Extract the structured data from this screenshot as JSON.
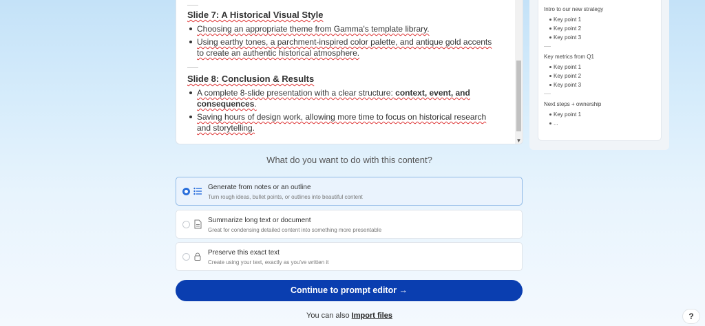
{
  "editor": {
    "slide7": {
      "title": "Slide 7: A Historical Visual Style",
      "bullets": [
        "Choosing an appropriate theme from Gamma's template library.",
        "Using earthy tones, a parchment-inspired color palette, and antique gold accents to create an authentic historical atmosphere."
      ]
    },
    "slide8": {
      "title": "Slide 8: Conclusion & Results",
      "bullet1_pre": "A complete 8-slide presentation with a clear structure: ",
      "bullet1_bold": "context, event, and consequences",
      "bullet1_post": ".",
      "bullet2": "Saving hours of design work, allowing more time to focus on historical research and storytelling."
    }
  },
  "preview": {
    "groups": [
      {
        "title": "Intro to our new strategy",
        "items": [
          "Key point 1",
          "Key point 2",
          "Key point 3"
        ]
      },
      {
        "title": "Key metrics from Q1",
        "items": [
          "Key point 1",
          "Key point 2",
          "Key point 3"
        ]
      },
      {
        "title": "Next steps + ownership",
        "items": [
          "Key point 1",
          "..."
        ]
      }
    ]
  },
  "question": "What do you want to do with this content?",
  "options": [
    {
      "title": "Generate from notes or an outline",
      "desc": "Turn rough ideas, bullet points, or outlines into beautiful content",
      "icon": "list-icon",
      "selected": true
    },
    {
      "title": "Summarize long text or document",
      "desc": "Great for condensing detailed content into something more presentable",
      "icon": "document-icon",
      "selected": false
    },
    {
      "title": "Preserve this exact text",
      "desc": "Create using your text, exactly as you've written it",
      "icon": "lock-icon",
      "selected": false
    }
  ],
  "continue_label": "Continue to prompt editor →",
  "import": {
    "prefix": "You can also ",
    "link": "Import files"
  },
  "help_label": "?",
  "colors": {
    "accent": "#0a3eb0",
    "radio": "#2a6fdb",
    "selected_bg": "#eaf3fd"
  }
}
